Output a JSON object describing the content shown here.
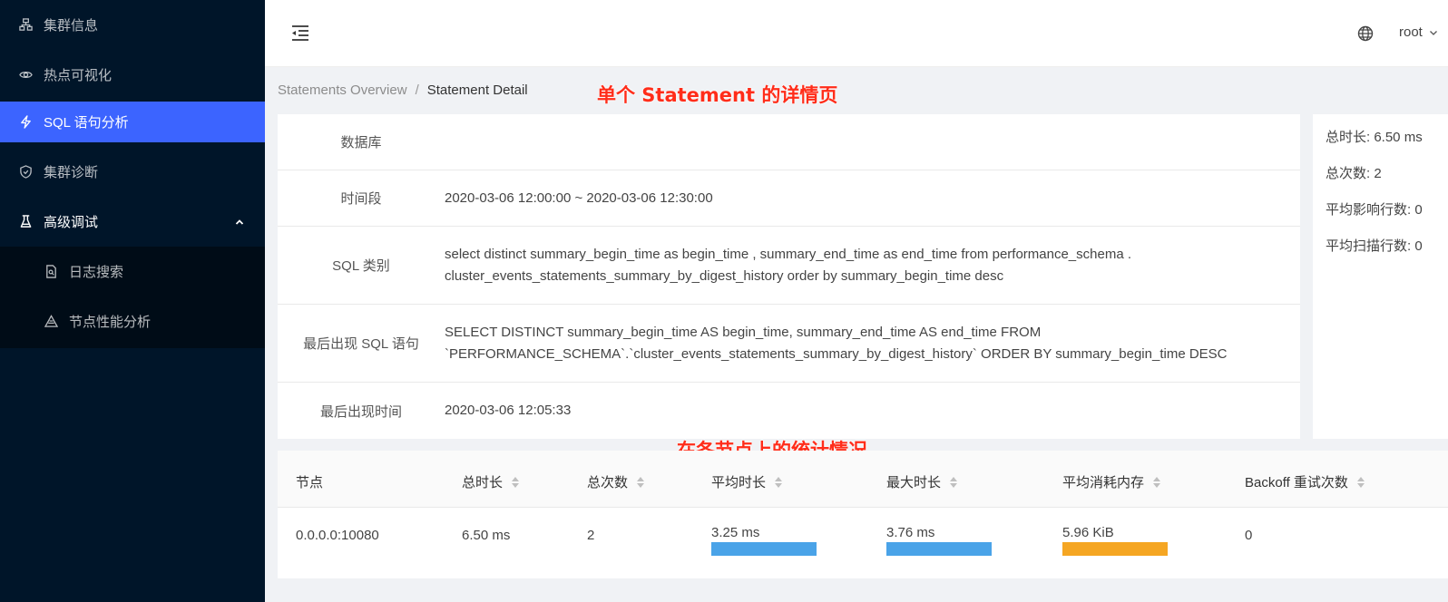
{
  "sidebar": {
    "items": [
      {
        "label": "集群信息",
        "icon": "cluster-icon"
      },
      {
        "label": "热点可视化",
        "icon": "eye-icon"
      },
      {
        "label": "SQL 语句分析",
        "icon": "lightning-icon",
        "active": true
      },
      {
        "label": "集群诊断",
        "icon": "shield-icon"
      },
      {
        "label": "高级调试",
        "icon": "flask-icon",
        "open": true
      }
    ],
    "submenu": [
      {
        "label": "日志搜索",
        "icon": "file-search-icon"
      },
      {
        "label": "节点性能分析",
        "icon": "triangle-icon"
      }
    ]
  },
  "header": {
    "user": "root"
  },
  "breadcrumb": {
    "parent": "Statements Overview",
    "separator": "/",
    "current": "Statement Detail"
  },
  "annotations": {
    "top": "单个 Statement 的详情页",
    "bottom": "在各节点上的统计情况"
  },
  "detail": {
    "rows": [
      {
        "label": "数据库",
        "value": ""
      },
      {
        "label": "时间段",
        "value": "2020-03-06 12:00:00 ~ 2020-03-06 12:30:00"
      },
      {
        "label": "SQL 类别",
        "value": "select distinct summary_begin_time as begin_time , summary_end_time as end_time from performance_schema . cluster_events_statements_summary_by_digest_history order by summary_begin_time desc"
      },
      {
        "label": "最后出现 SQL 语句",
        "value": "SELECT DISTINCT summary_begin_time AS begin_time, summary_end_time AS end_time FROM `PERFORMANCE_SCHEMA`.`cluster_events_statements_summary_by_digest_history` ORDER BY summary_begin_time DESC"
      },
      {
        "label": "最后出现时间",
        "value": "2020-03-06 12:05:33"
      }
    ]
  },
  "stats": {
    "total_duration": "总时长: 6.50 ms",
    "total_count": "总次数: 2",
    "avg_affected_rows": "平均影响行数: 0",
    "avg_scanned_rows": "平均扫描行数: 0"
  },
  "table": {
    "columns": [
      "节点",
      "总时长",
      "总次数",
      "平均时长",
      "最大时长",
      "平均消耗内存",
      "Backoff 重试次数"
    ],
    "rows": [
      {
        "node": "0.0.0.0:10080",
        "total_duration": "6.50 ms",
        "total_count": "2",
        "avg_duration": "3.25 ms",
        "max_duration": "3.76 ms",
        "avg_mem": "5.96 KiB",
        "backoff": "0"
      }
    ],
    "bar_colors": {
      "avg_duration": "#4aa3e8",
      "max_duration": "#4aa3e8",
      "avg_mem": "#f5a623"
    }
  },
  "colors": {
    "sidebar_bg": "#001529",
    "active_item": "#3c64ff",
    "annotation": "#ff2d1a"
  }
}
